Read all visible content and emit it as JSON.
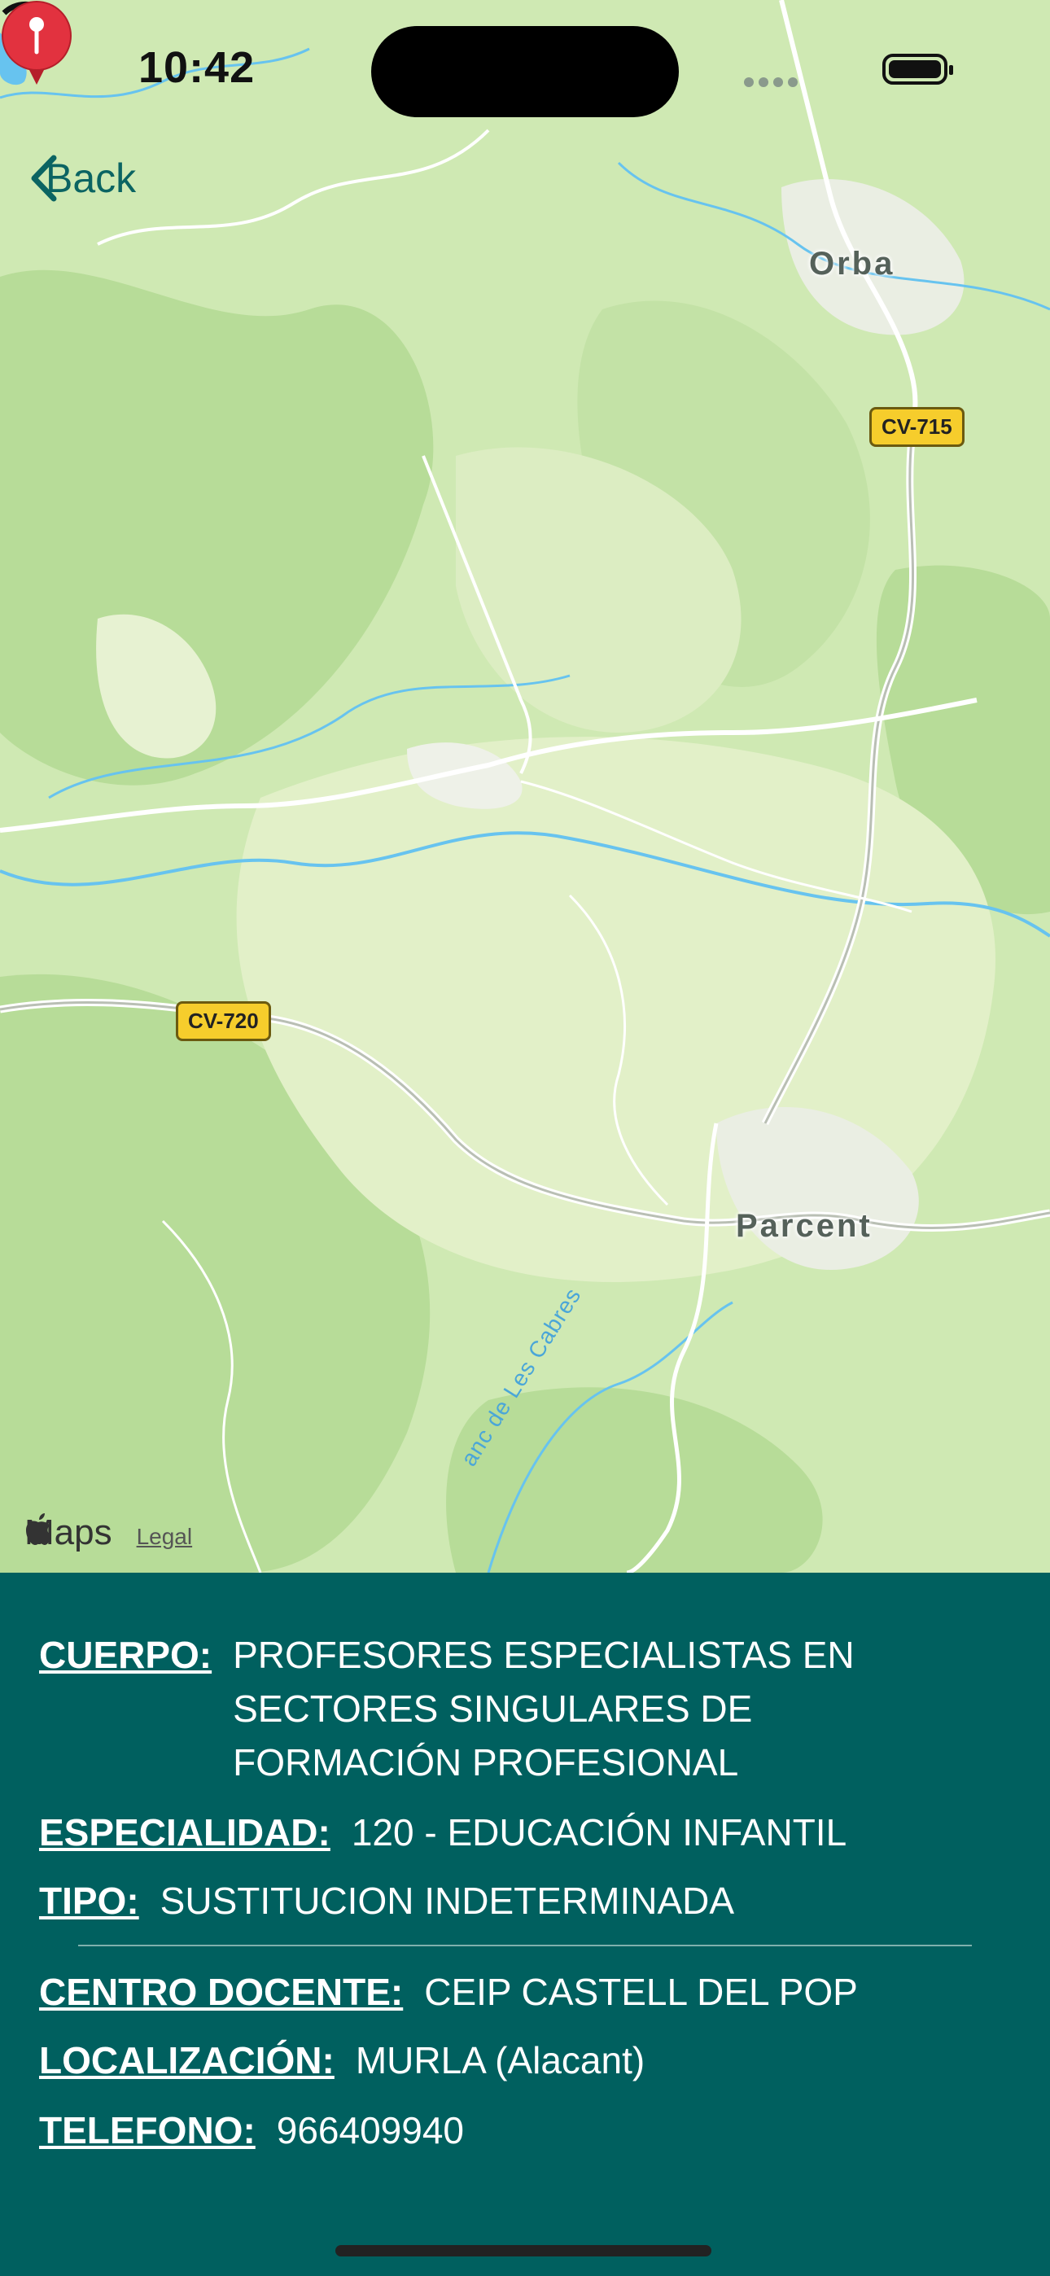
{
  "status": {
    "time": "10:42"
  },
  "nav": {
    "back_label": "Back"
  },
  "map": {
    "places": {
      "orba": "Orba",
      "parcent": "Parcent"
    },
    "roads": {
      "cv715": "CV-715",
      "cv720": "CV-720"
    },
    "stream": "anc de Les Cabres",
    "attribution": {
      "logo": "Maps",
      "legal": "Legal"
    },
    "icons": {
      "pin": "map-pin-icon",
      "apple": "apple-logo-icon"
    }
  },
  "details": {
    "cuerpo_label": "CUERPO:",
    "cuerpo_value": "PROFESORES ESPECIALISTAS EN SECTORES SINGULARES DE FORMACIÓN PROFESIONAL",
    "especialidad_label": "ESPECIALIDAD:",
    "especialidad_value": "120 - EDUCACIÓN INFANTIL",
    "tipo_label": "TIPO:",
    "tipo_value": "SUSTITUCION INDETERMINADA",
    "centro_label": "CENTRO DOCENTE:",
    "centro_value": "CEIP CASTELL DEL POP",
    "localizacion_label": "LOCALIZACIÓN:",
    "localizacion_value": "MURLA (Alacant)",
    "telefono_label": "TELEFONO:",
    "telefono_value": "966409940"
  },
  "colors": {
    "panel": "#00605f",
    "accent": "#0b6462",
    "pin": "#e2323f",
    "shield": "#f6cd2c"
  }
}
